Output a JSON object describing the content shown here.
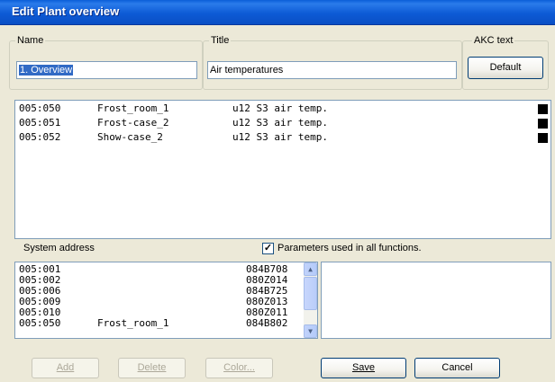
{
  "window": {
    "title": "Edit Plant overview"
  },
  "name_group": {
    "legend": "Name",
    "value": "1. Overview"
  },
  "title_group": {
    "legend": "Title",
    "value": "Air temperatures"
  },
  "akc_group": {
    "legend": "AKC text",
    "default_label": "Default"
  },
  "plant_list": {
    "rows": [
      {
        "address": "005:050",
        "name": "Frost_room_1",
        "parameter": "u12 S3 air temp.",
        "color": "#000000"
      },
      {
        "address": "005:051",
        "name": "Frost-case_2",
        "parameter": "u12 S3 air temp.",
        "color": "#000000"
      },
      {
        "address": "005:052",
        "name": "Show-case_2",
        "parameter": "u12 S3 air temp.",
        "color": "#000000"
      }
    ]
  },
  "system_address": {
    "label": "System address",
    "checkbox_label": "Parameters used in all functions.",
    "checkbox_checked": true,
    "rows": [
      {
        "address": "005:001",
        "name": "",
        "code": "084B708"
      },
      {
        "address": "005:002",
        "name": "",
        "code": "080Z014"
      },
      {
        "address": "005:006",
        "name": "",
        "code": "084B725"
      },
      {
        "address": "005:009",
        "name": "",
        "code": "080Z013"
      },
      {
        "address": "005:010",
        "name": "",
        "code": "080Z011"
      },
      {
        "address": "005:050",
        "name": "Frost_room_1",
        "code": "084B802"
      }
    ]
  },
  "buttons": {
    "add": "Add",
    "delete": "Delete",
    "color": "Color...",
    "save": "Save",
    "cancel": "Cancel"
  },
  "icons": {
    "scroll_up": "chevron-up-icon",
    "scroll_down": "chevron-down-icon",
    "check": "checkmark-icon"
  }
}
